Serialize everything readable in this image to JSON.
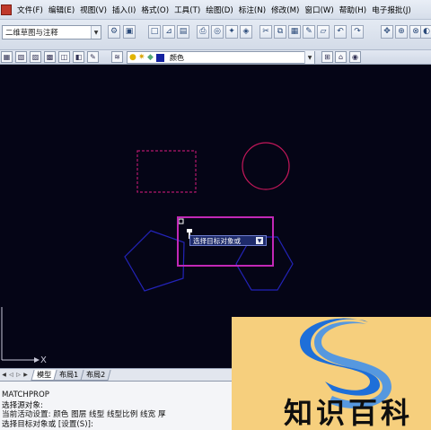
{
  "menu": {
    "items": [
      "文件(F)",
      "编辑(E)",
      "视图(V)",
      "插入(I)",
      "格式(O)",
      "工具(T)",
      "绘图(D)",
      "标注(N)",
      "修改(M)",
      "窗口(W)",
      "帮助(H)",
      "电子报批(J)"
    ]
  },
  "toolbar": {
    "workspace_value": "二维草图与注释",
    "layer_value": "颜色"
  },
  "canvas": {
    "tooltip_text": "选择目标对象或",
    "axis_x_label": "X",
    "colors": {
      "background": "#050516",
      "dashed_rect": "#b3186e",
      "circle": "#c4175a",
      "polygons": "#2323b8",
      "highlight": "#c228b6"
    }
  },
  "tabs": {
    "items": [
      "模型",
      "布局1",
      "布局2"
    ],
    "active": "模型"
  },
  "command": {
    "lines": [
      "MATCHPROP",
      "选择源对象:",
      "当前活动设置:  颜色 图层 线型 线型比例 线宽 厚",
      "选择目标对象或 [设置(S)]:"
    ]
  },
  "overlay": {
    "watermark_text": "知识百科",
    "accent_orange": "#f6cf7d",
    "logo_blue": "#1e6fd9"
  }
}
